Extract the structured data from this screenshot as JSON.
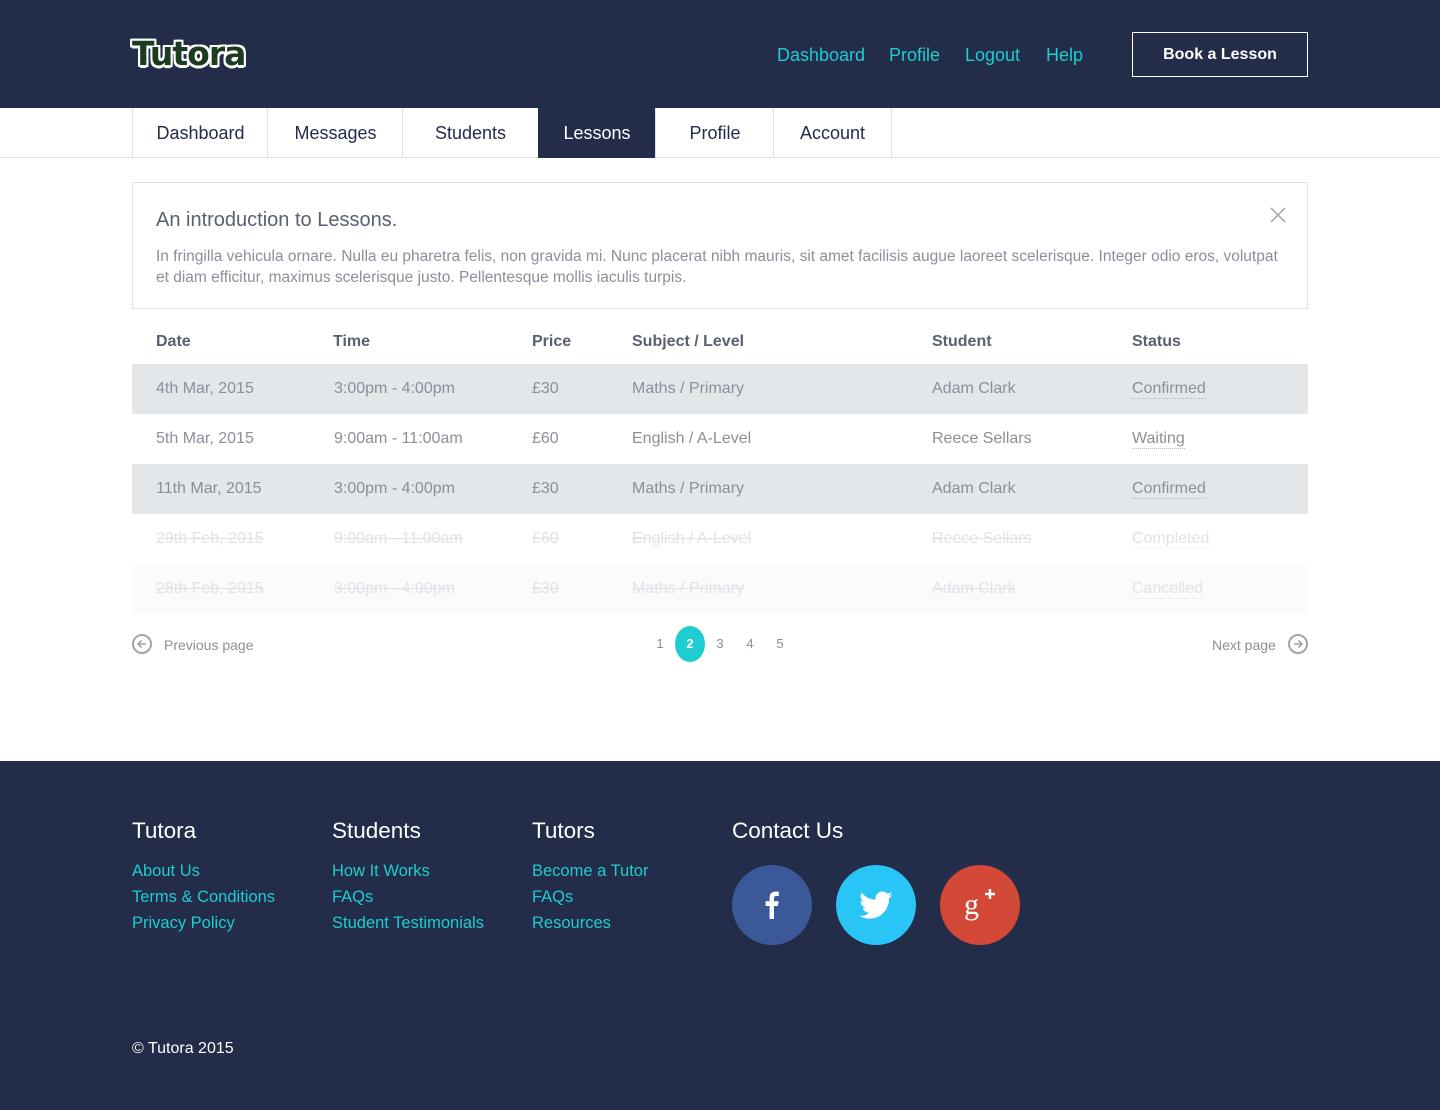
{
  "header": {
    "logo": "Tutora",
    "nav": [
      "Dashboard",
      "Profile",
      "Logout",
      "Help"
    ],
    "cta": "Book a Lesson"
  },
  "tabs": [
    {
      "label": "Dashboard",
      "active": false
    },
    {
      "label": "Messages",
      "active": false
    },
    {
      "label": "Students",
      "active": false
    },
    {
      "label": "Lessons",
      "active": true
    },
    {
      "label": "Profile",
      "active": false
    },
    {
      "label": "Account",
      "active": false
    }
  ],
  "intro": {
    "title": "An introduction to Lessons.",
    "text": "In fringilla vehicula ornare. Nulla eu pharetra felis, non gravida mi. Nunc placerat nibh mauris, sit amet facilisis augue laoreet scelerisque. Integer odio eros, volutpat et diam efficitur, maximus scelerisque justo. Pellentesque mollis iaculis turpis.",
    "close_icon": "close-icon"
  },
  "table": {
    "headers": [
      "Date",
      "Time",
      "Price",
      "Subject / Level",
      "Student",
      "Status"
    ],
    "rows": [
      {
        "date": "4th Mar, 2015",
        "time": "3:00pm - 4:00pm",
        "price": "£30",
        "subject": "Maths / Primary",
        "student": "Adam Clark",
        "status": "Confirmed"
      },
      {
        "date": "5th Mar, 2015",
        "time": "9:00am - 11:00am",
        "price": "£60",
        "subject": "English / A-Level",
        "student": "Reece Sellars",
        "status": "Waiting"
      },
      {
        "date": "11th Mar, 2015",
        "time": "3:00pm - 4:00pm",
        "price": "£30",
        "subject": "Maths / Primary",
        "student": "Adam Clark",
        "status": "Confirmed"
      },
      {
        "date": "29th Feb, 2015",
        "time": "9:00am - 11:00am",
        "price": "£60",
        "subject": "English / A-Level",
        "student": "Reece Sellars",
        "status": "Completed"
      },
      {
        "date": "28th Feb, 2015",
        "time": "3:00pm - 4:00pm",
        "price": "£30",
        "subject": "Maths / Primary",
        "student": "Adam Clark",
        "status": "Cancelled"
      }
    ]
  },
  "pagination": {
    "prev": "Previous page",
    "next": "Next page",
    "pages": [
      "1",
      "2",
      "3",
      "4",
      "5"
    ],
    "current": "2"
  },
  "footer": {
    "columns": [
      {
        "heading": "Tutora",
        "links": [
          "About Us",
          "Terms & Conditions",
          "Privacy Policy"
        ]
      },
      {
        "heading": "Students",
        "links": [
          "How It Works",
          "FAQs",
          "Student Testimonials"
        ]
      },
      {
        "heading": "Tutors",
        "links": [
          "Become a Tutor",
          "FAQs",
          "Resources"
        ]
      }
    ],
    "contact_heading": "Contact Us",
    "social": [
      {
        "icon": "facebook-icon",
        "color": "#3b5998"
      },
      {
        "icon": "twitter-icon",
        "color": "#29c5f6"
      },
      {
        "icon": "google-plus-icon",
        "color": "#d34836"
      }
    ],
    "copyright": "© Tutora 2015"
  },
  "colors": {
    "navy": "#232c48",
    "accent": "#1ecdd0"
  }
}
